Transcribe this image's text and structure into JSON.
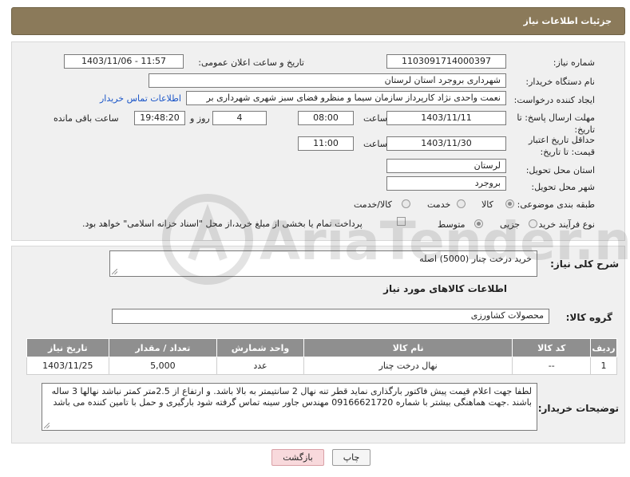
{
  "header": {
    "title": "جزئیات اطلاعات نیاز"
  },
  "form": {
    "need_number_label": "شماره نیاز:",
    "need_number": "1103091714000397",
    "announce_label": "تاریخ و ساعت اعلان عمومی:",
    "announce_value": "1403/11/06 - 11:57",
    "buyer_org_label": "نام دستگاه خریدار:",
    "buyer_org": "شهرداری بروجرد استان لرستان",
    "creator_label": "ایجاد کننده درخواست:",
    "creator": "نعمت واحدی نژاد کارپرداز سازمان سیما و منظرو فضای سبز شهری شهرداری بر",
    "contact_link": "اطلاعات تماس خریدار",
    "deadline_label": "مهلت ارسال پاسخ: تا تاریخ:",
    "deadline_date": "1403/11/11",
    "time_label": "ساعت",
    "deadline_time": "08:00",
    "days_value": "4",
    "days_label": "روز و",
    "remaining_time": "19:48:20",
    "remaining_label": "ساعت باقی مانده",
    "validity_label": "حداقل تاریخ اعتبار قیمت: تا تاریخ:",
    "validity_date": "1403/11/30",
    "validity_time_label": "ساعت",
    "validity_time": "11:00",
    "province_label": "استان محل تحویل:",
    "province": "لرستان",
    "city_label": "شهر محل تحویل:",
    "city": "بروجرد",
    "category_label": "طبقه بندی موضوعی:",
    "category_options": [
      "کالا",
      "خدمت",
      "کالا/خدمت"
    ],
    "process_label": "نوع فرآیند خرید :",
    "process_options": [
      "جزیی",
      "متوسط"
    ],
    "payment_note": "پرداخت تمام یا بخشی از مبلغ خرید،از محل \"اسناد خزانه اسلامی\" خواهد بود."
  },
  "details": {
    "summary_label": "شرح کلی نیاز:",
    "summary": "خرید درخت چنار (5000) اصله",
    "goods_info_title": "اطلاعات کالاهای مورد نیاز",
    "goods_group_label": "گروه کالا:",
    "goods_group": "محصولات کشاورزی",
    "table": {
      "headers": [
        "ردیف",
        "کد کالا",
        "نام کالا",
        "واحد شمارش",
        "تعداد / مقدار",
        "تاریخ نیاز"
      ],
      "rows": [
        [
          "1",
          "--",
          "نهال درخت چنار",
          "عدد",
          "5,000",
          "1403/11/25"
        ]
      ]
    },
    "buyer_notes_label": "توضیحات خریدار:",
    "buyer_notes": "لطفا جهت اعلام قیمت پیش فاکتور بارگذاری نماید قطر تنه نهال 2 سانتیمتر به بالا باشد. و ارتفاع از 2.5متر کمتر نباشد  نهالها 3 ساله باشند .جهت هماهنگی بیشتر با شماره 09166621720 مهندس جاور سینه تماس گرفته شود بارگیری و حمل با تامین کننده می باشد"
  },
  "buttons": {
    "print": "چاپ",
    "back": "بازگشت"
  },
  "watermark": "AriaTender.neT"
}
